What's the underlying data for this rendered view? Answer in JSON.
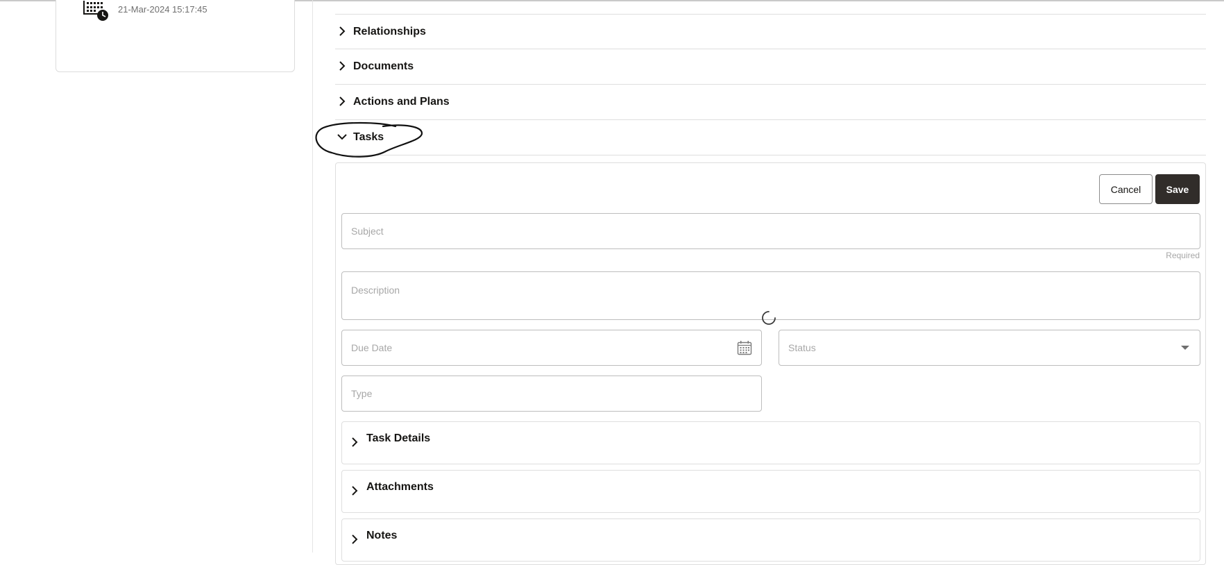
{
  "left_card": {
    "timestamp": "21-Mar-2024 15:17:45",
    "icon": "calendar-clock-icon"
  },
  "sections": [
    {
      "label": "Relationships",
      "expanded": false
    },
    {
      "label": "Documents",
      "expanded": false
    },
    {
      "label": "Actions and Plans",
      "expanded": false
    },
    {
      "label": "Tasks",
      "expanded": true
    }
  ],
  "task_form": {
    "cancel_label": "Cancel",
    "save_label": "Save",
    "subject_placeholder": "Subject",
    "required_hint": "Required",
    "description_placeholder": "Description",
    "due_date_placeholder": "Due Date",
    "status_placeholder": "Status",
    "type_placeholder": "Type",
    "sub_sections": [
      {
        "label": "Task Details"
      },
      {
        "label": "Attachments"
      },
      {
        "label": "Notes"
      }
    ]
  },
  "colors": {
    "save_button_bg": "#312d2a",
    "border": "#dedede",
    "placeholder": "#a7a7a7"
  }
}
